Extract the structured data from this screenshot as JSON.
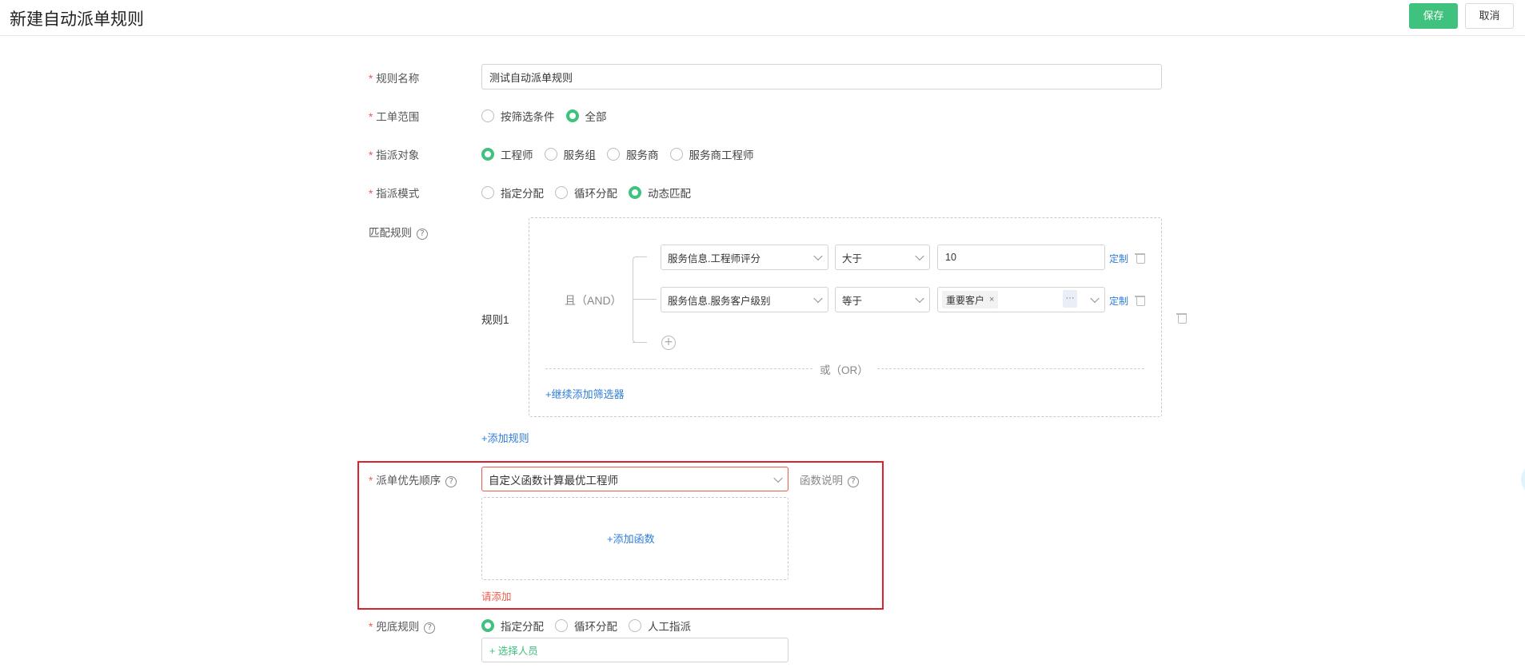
{
  "header": {
    "title": "新建自动派单规则",
    "save_label": "保存",
    "cancel_label": "取消"
  },
  "form": {
    "rule_name": {
      "label": "规则名称",
      "value": "测试自动派单规则"
    },
    "scope": {
      "label": "工单范围",
      "options": [
        "按筛选条件",
        "全部"
      ],
      "selected": "全部"
    },
    "target": {
      "label": "指派对象",
      "options": [
        "工程师",
        "服务组",
        "服务商",
        "服务商工程师"
      ],
      "selected": "工程师"
    },
    "mode": {
      "label": "指派模式",
      "options": [
        "指定分配",
        "循环分配",
        "动态匹配"
      ],
      "selected": "动态匹配"
    },
    "match_rules": {
      "label": "匹配规则",
      "rule_title": "规则1",
      "and_label": "且（AND）",
      "or_label": "或（OR）",
      "conditions": [
        {
          "field": "服务信息.工程师评分",
          "operator": "大于",
          "value": "10",
          "custom_label": "定制"
        },
        {
          "field": "服务信息.服务客户级别",
          "operator": "等于",
          "tag": "重要客户",
          "tag_close": "×",
          "more": "···",
          "custom_label": "定制"
        }
      ],
      "add_filter_label": "+继续添加筛选器",
      "add_rule_label": "+添加规则"
    },
    "priority": {
      "label": "派单优先顺序",
      "selected": "自定义函数计算最优工程师",
      "fn_help_label": "函数说明",
      "add_fn_label": "+添加函数",
      "error": "请添加"
    },
    "fallback": {
      "label": "兜底规则",
      "options": [
        "指定分配",
        "循环分配",
        "人工指派"
      ],
      "selected": "指定分配",
      "select_person_label": "+ 选择人员"
    },
    "required_mark": "*",
    "help_mark": "?"
  },
  "colors": {
    "accent": "#3ec27d",
    "link": "#2f7dd6",
    "error": "#f05a4a",
    "highlight": "#d9232c"
  }
}
